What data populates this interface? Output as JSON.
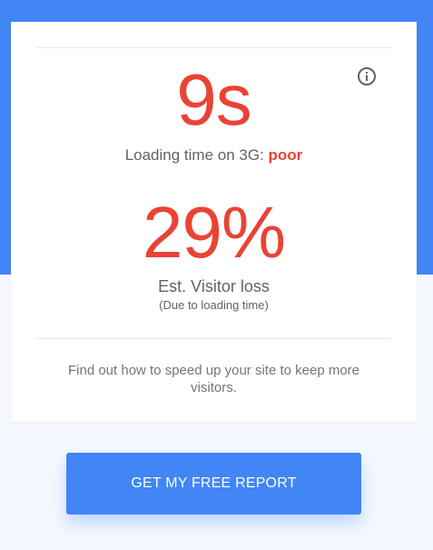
{
  "colors": {
    "accent": "#4285f4",
    "metric_red": "#ea4335",
    "text_gray": "#5f6368",
    "muted_gray": "#757575"
  },
  "info_button": {
    "icon": "info-icon"
  },
  "loading": {
    "value": "9s",
    "label": "Loading time on 3G:",
    "rating": "poor"
  },
  "visitor_loss": {
    "value": "29%",
    "label": "Est. Visitor loss",
    "sublabel": "(Due to loading time)"
  },
  "cta": {
    "text": "Find out how to speed up your site to keep more visitors.",
    "button_label": "GET MY FREE REPORT"
  }
}
